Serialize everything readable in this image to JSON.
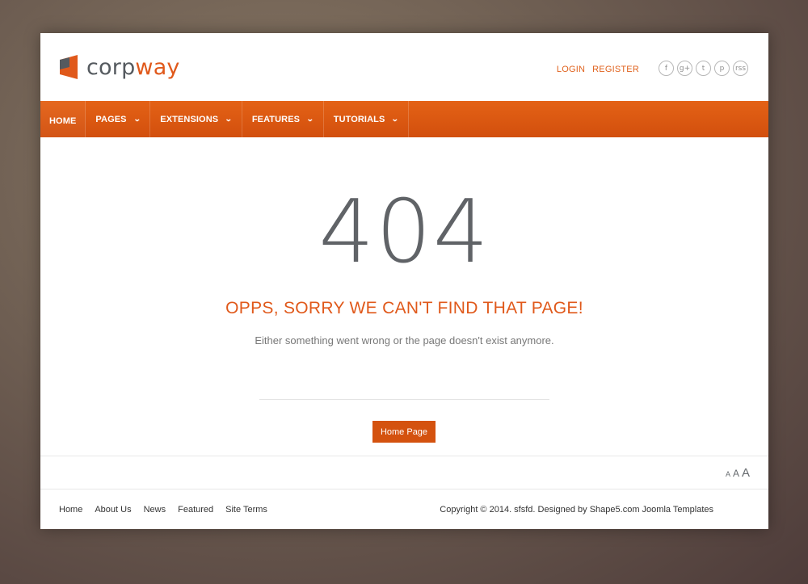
{
  "logo": {
    "part1": "corp",
    "part2": "way",
    "icon": "logo-icon"
  },
  "header": {
    "login_label": "LOGIN",
    "register_label": "REGISTER",
    "social": [
      {
        "icon": "facebook-icon",
        "glyph": "f"
      },
      {
        "icon": "google-plus-icon",
        "glyph": "g+"
      },
      {
        "icon": "twitter-icon",
        "glyph": "t"
      },
      {
        "icon": "pinterest-icon",
        "glyph": "p"
      },
      {
        "icon": "rss-icon",
        "glyph": "rss"
      }
    ]
  },
  "nav": {
    "items": [
      {
        "label": "HOME",
        "dropdown": false
      },
      {
        "label": "PAGES",
        "dropdown": true
      },
      {
        "label": "EXTENSIONS",
        "dropdown": true
      },
      {
        "label": "FEATURES",
        "dropdown": true
      },
      {
        "label": "TUTORIALS",
        "dropdown": true
      }
    ]
  },
  "error": {
    "code": "404",
    "headline": "OPPS, SORRY WE CAN'T FIND THAT PAGE!",
    "message": "Either something went wrong or the page doesn't exist anymore.",
    "button_label": "Home Page"
  },
  "font_resize": {
    "small": "A",
    "medium": "A",
    "large": "A"
  },
  "footer": {
    "links": [
      "Home",
      "About Us",
      "News",
      "Featured",
      "Site Terms"
    ],
    "copyright": "Copyright © 2014. sfsfd. Designed by Shape5.com Joomla Templates"
  },
  "colors": {
    "accent": "#e0591b",
    "nav_bg": "#d9560f",
    "text_dark": "#606367"
  }
}
